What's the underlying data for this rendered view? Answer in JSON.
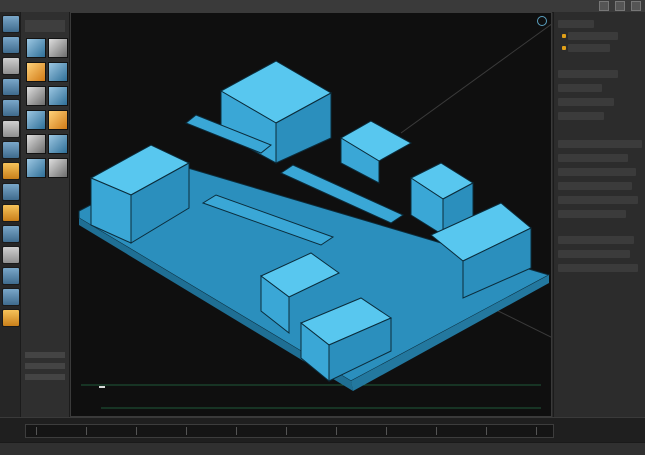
{
  "window": {
    "title": ""
  },
  "viewport": {
    "label": ""
  },
  "status": {
    "text": ""
  },
  "colors": {
    "model": "#3aa7d6",
    "model_top": "#58c7ef",
    "model_side": "#2b8fbd",
    "background": "#0f0f0f"
  }
}
